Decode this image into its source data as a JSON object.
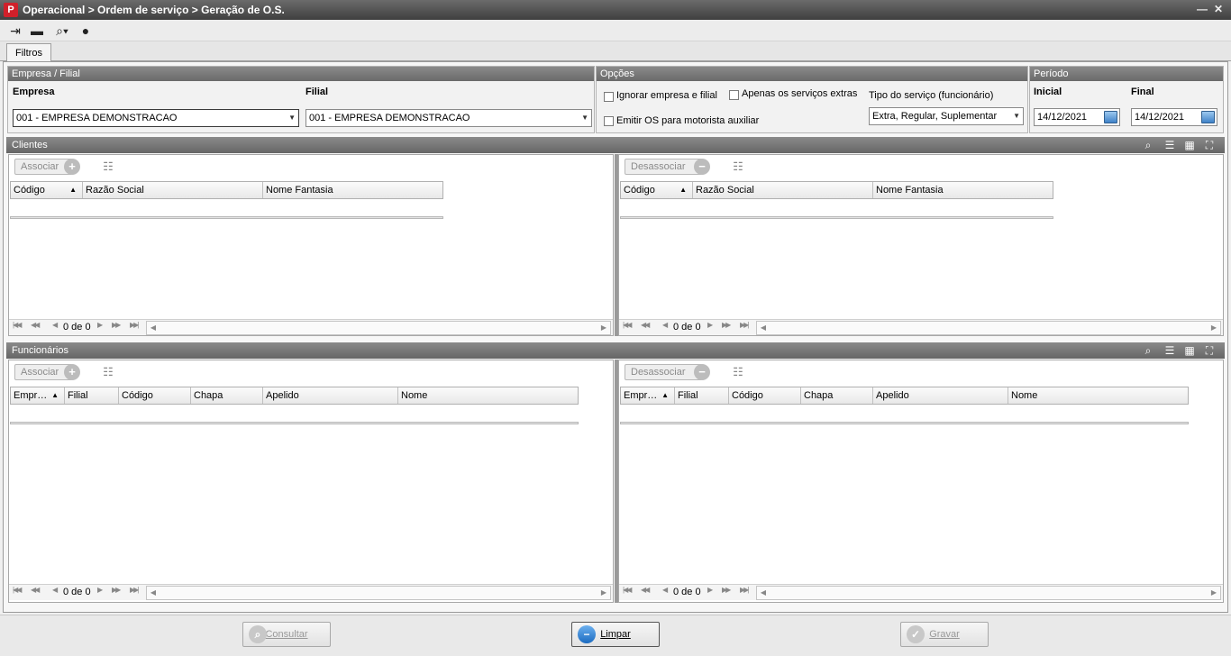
{
  "window": {
    "title": "Operacional > Ordem de serviço > Geração de O.S.",
    "logo_glyph": "P",
    "min_glyph": "—",
    "close_glyph": "✕"
  },
  "toolbar": {
    "icons": [
      "exit-icon",
      "message-icon",
      "search-dropdown-icon",
      "user-icon"
    ]
  },
  "tabs": [
    {
      "label": "Filtros"
    }
  ],
  "empresa_filial": {
    "title": "Empresa / Filial",
    "empresa_label": "Empresa",
    "empresa_value": "001 - EMPRESA DEMONSTRACAO",
    "filial_label": "Filial",
    "filial_value": "001 - EMPRESA DEMONSTRACAO"
  },
  "opcoes": {
    "title": "Opções",
    "ignorar_label": "Ignorar empresa e filial",
    "apenas_label": "Apenas os serviços extras",
    "emitir_label": "Emitir OS para motorista auxiliar",
    "tipo_label": "Tipo do serviço (funcionário)",
    "tipo_value": "Extra, Regular, Suplementar"
  },
  "periodo": {
    "title": "Período",
    "inicial_label": "Inicial",
    "inicial_value": "14/12/2021",
    "final_label": "Final",
    "final_value": "14/12/2021"
  },
  "clientes": {
    "title": "Clientes",
    "associar_label": "Associar",
    "desassociar_label": "Desassociar",
    "columns": [
      "Código",
      "Razão Social",
      "Nome Fantasia"
    ],
    "pager_text": "0 de 0"
  },
  "funcionarios": {
    "title": "Funcionários",
    "associar_label": "Associar",
    "desassociar_label": "Desassociar",
    "columns": [
      "Empr…",
      "Filial",
      "Código",
      "Chapa",
      "Apelido",
      "Nome"
    ],
    "pager_text": "0 de 0"
  },
  "footer": {
    "consultar_label": "Consultar",
    "limpar_label": "Limpar",
    "gravar_label": "Gravar"
  },
  "colors": {
    "titlebar": "#4a4a4a",
    "section_header": "#777777",
    "accent": "#2a7ad0"
  }
}
